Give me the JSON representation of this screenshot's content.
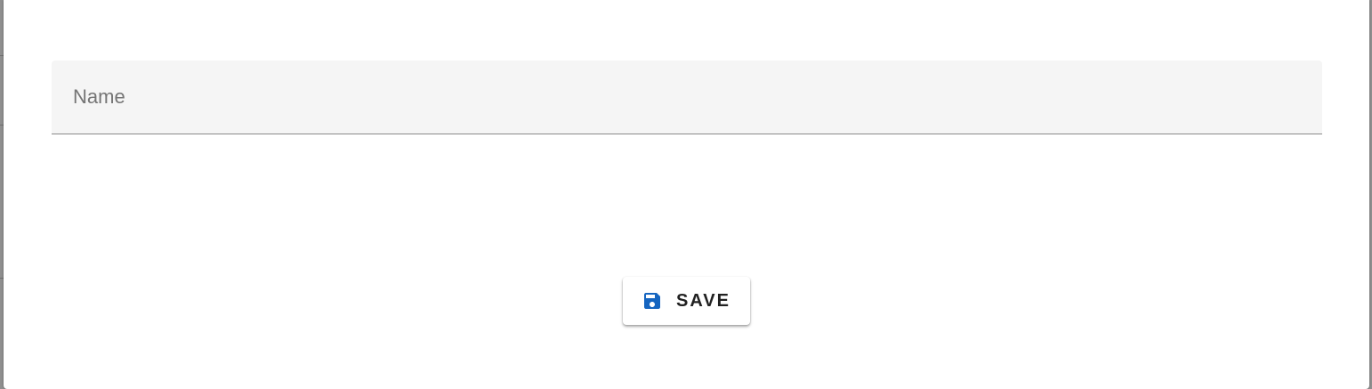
{
  "form": {
    "name_field": {
      "placeholder": "Name",
      "value": ""
    }
  },
  "actions": {
    "save_label": "SAVE",
    "save_icon": "floppy-disk-icon"
  },
  "colors": {
    "accent": "#1565c0",
    "field_background": "#f5f5f5",
    "text_primary": "#212121",
    "placeholder": "#757575"
  }
}
